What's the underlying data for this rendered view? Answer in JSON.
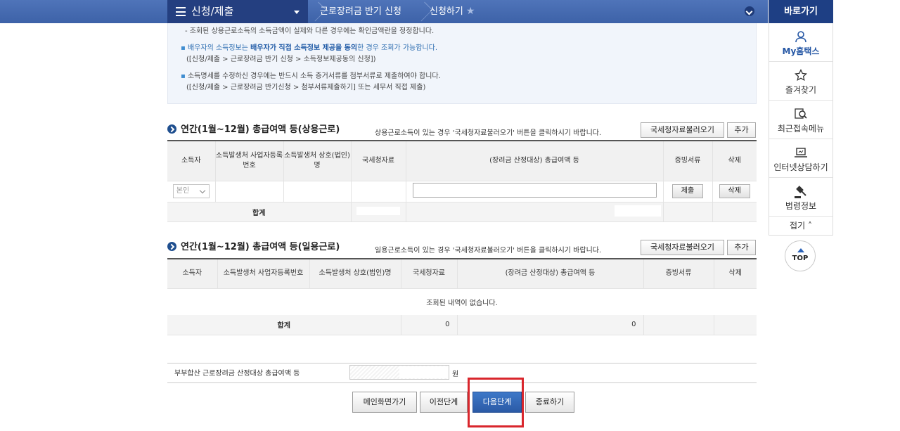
{
  "topnav": {
    "menu_label": "신청/제출",
    "crumb1": "근로장려금 반기 신청",
    "crumb2": "신청하기",
    "quick_title": "바로가기"
  },
  "quick": {
    "items": [
      {
        "label": "My홈택스",
        "icon": "person-icon"
      },
      {
        "label": "즐겨찾기",
        "icon": "star-icon"
      },
      {
        "label": "최근접속메뉴",
        "icon": "recent-search-icon"
      },
      {
        "label": "인터넷상담하기",
        "icon": "laptop-icon"
      },
      {
        "label": "법령정보",
        "icon": "gavel-icon"
      }
    ],
    "fold": "접기",
    "top": "TOP"
  },
  "info": {
    "line1": "- 조회된 상용근로소득의 소득금액이 실제와 다른 경우에는 확인금액란을 정정합니다.",
    "line2_pre": "배우자의 소득정보는 ",
    "line2_bold": "배우자가 직접 소득정보 제공을 동의",
    "line2_post": "한 경우 조회가 가능합니다.",
    "line3": "([신청/제출 > 근로장려금 반기 신청 > 소득정보제공동의 신청])",
    "line4": "소득명세를 수정하신 경우에는 반드시 소득 증거서류를 첨부서류로 제출하여야 합니다.",
    "line5": "([신청/제출 > 근로장려금 반기신청 > 첨부서류제출하기] 또는 세무서 직접 제출)"
  },
  "section1": {
    "title": "연간(1월~12월) 총급여액 등(상용근로)",
    "note": "상용근로소득이 있는 경우 '국세청자료불러오기' 버튼을 클릭하시기 바랍니다.",
    "load_btn": "국세청자료불러오기",
    "add_btn": "추가",
    "headers": [
      "소득자",
      "소득발생처 사업자등록번호",
      "소득발생처 상호(법인)명",
      "국세청자료",
      "(장려금 산정대상) 총급여액 등",
      "증빙서류",
      "삭제"
    ],
    "row": {
      "earner": "본인",
      "submit_btn": "제출",
      "delete_btn": "삭제"
    },
    "sum_label": "합계"
  },
  "section2": {
    "title": "연간(1월~12월) 총급여액 등(일용근로)",
    "note": "일용근로소득이 있는 경우 '국세청자료불러오기' 버튼을 클릭하시기 바랍니다.",
    "load_btn": "국세청자료불러오기",
    "add_btn": "추가",
    "headers": [
      "소득자",
      "소득발생처 사업자등록번호",
      "소득발생처 상호(법인)명",
      "국세청자료",
      "(장려금 산정대상) 총급여액 등",
      "증빙서류",
      "삭제"
    ],
    "empty": "조회된 내역이 없습니다.",
    "sum_label": "합계",
    "sum_nts": "0",
    "sum_total": "0"
  },
  "total": {
    "label": "부부합산 근로장려금 산정대상 총급여액 등",
    "unit": "원"
  },
  "buttons": {
    "main": "메인화면가기",
    "prev": "이전단계",
    "next": "다음단계",
    "end": "종료하기"
  }
}
